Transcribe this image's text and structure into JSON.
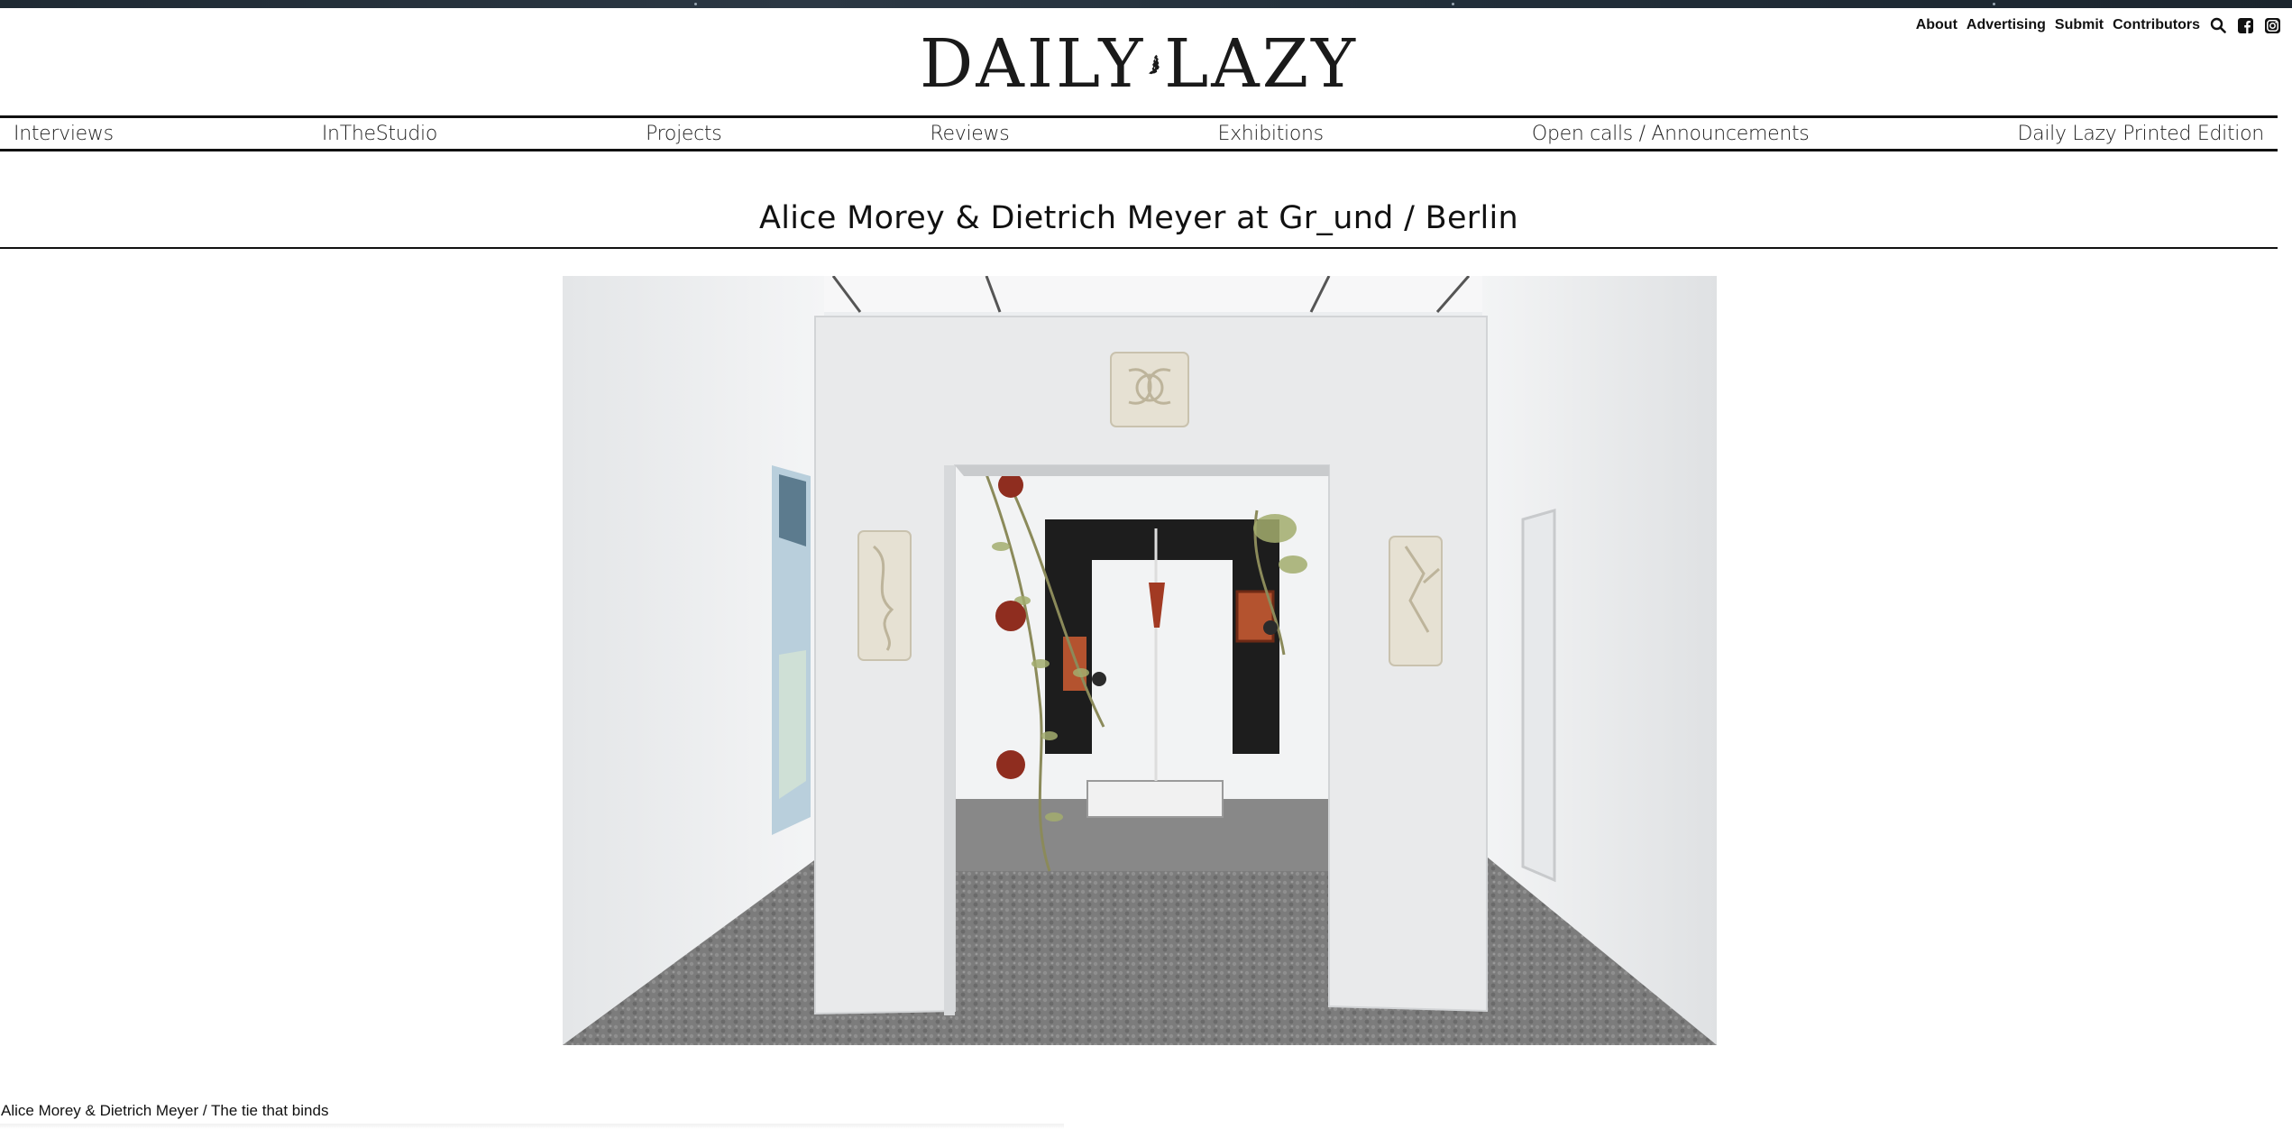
{
  "top_nav": {
    "links": [
      "About",
      "Advertising",
      "Submit",
      "Contributors"
    ],
    "icons": [
      "search-icon",
      "facebook-icon",
      "instagram-icon"
    ]
  },
  "logo": {
    "left_text": "DAILY",
    "right_text": "LAZY",
    "mark": "lazy-figure-logo-icon"
  },
  "main_nav": {
    "items": [
      "Interviews",
      "InTheStudio",
      "Projects",
      "Reviews",
      "Exhibitions",
      "Open calls / Announcements",
      "Daily Lazy Printed Edition"
    ]
  },
  "article": {
    "title": "Alice Morey & Dietrich Meyer at Gr_und / Berlin",
    "image_caption": "Alice Morey & Dietrich Meyer / The tie that binds"
  },
  "colors": {
    "text": "#111111",
    "background": "#ffffff",
    "top_strip": "#23303b"
  }
}
